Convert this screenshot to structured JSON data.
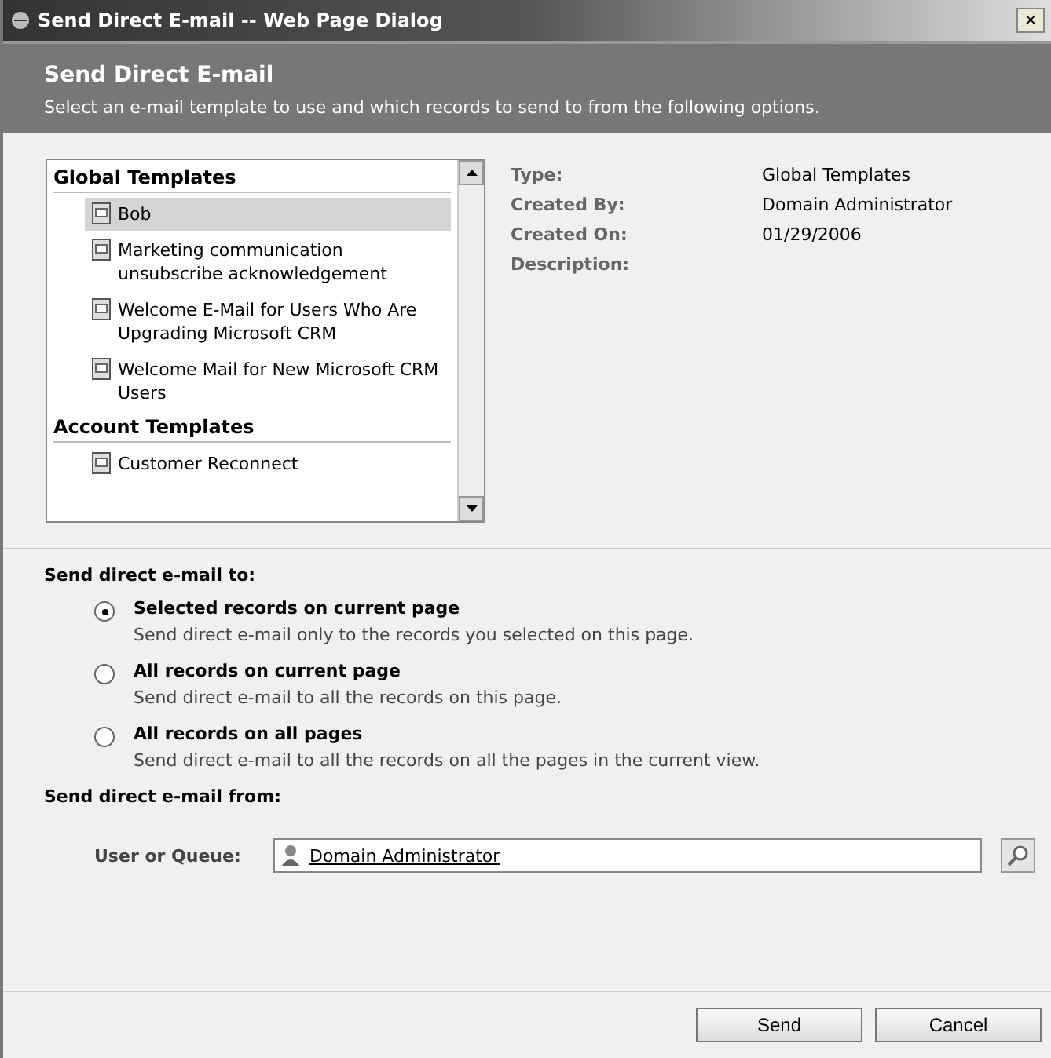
{
  "window": {
    "title": "Send Direct E-mail -- Web Page Dialog",
    "close": "×"
  },
  "header": {
    "title": "Send Direct E-mail",
    "subtitle": "Select an e-mail template to use and which records to send to from the following options."
  },
  "template_groups": [
    {
      "title": "Global Templates",
      "items": [
        {
          "label": "Bob",
          "selected": true
        },
        {
          "label": "Marketing communication unsubscribe acknowledgement",
          "selected": false
        },
        {
          "label": "Welcome E-Mail for Users Who Are Upgrading Microsoft CRM",
          "selected": false
        },
        {
          "label": "Welcome Mail for New Microsoft CRM Users",
          "selected": false
        }
      ]
    },
    {
      "title": "Account Templates",
      "items": [
        {
          "label": "Customer Reconnect",
          "selected": false
        }
      ]
    }
  ],
  "details": [
    {
      "label": "Type:",
      "value": "Global Templates"
    },
    {
      "label": "Created By:",
      "value": "Domain Administrator"
    },
    {
      "label": "Created On:",
      "value": "01/29/2006"
    },
    {
      "label": "Description:"
    }
  ],
  "send_to": {
    "title": "Send direct e-mail to:",
    "options": [
      {
        "label": "Selected records on current page",
        "hint": "Send direct e-mail only to the records you selected on this page.",
        "selected": true
      },
      {
        "label": "All records on current page",
        "hint": "Send direct e-mail to all the records on this page.",
        "selected": false
      },
      {
        "label": "All records on all pages",
        "hint": "Send direct e-mail to all the records on all the pages in the current view.",
        "selected": false
      }
    ]
  },
  "send_from": {
    "title": "Send direct e-mail from:",
    "label": "User or Queue:",
    "value": "Domain Administrator"
  },
  "buttons": [
    "Send",
    "Cancel"
  ]
}
